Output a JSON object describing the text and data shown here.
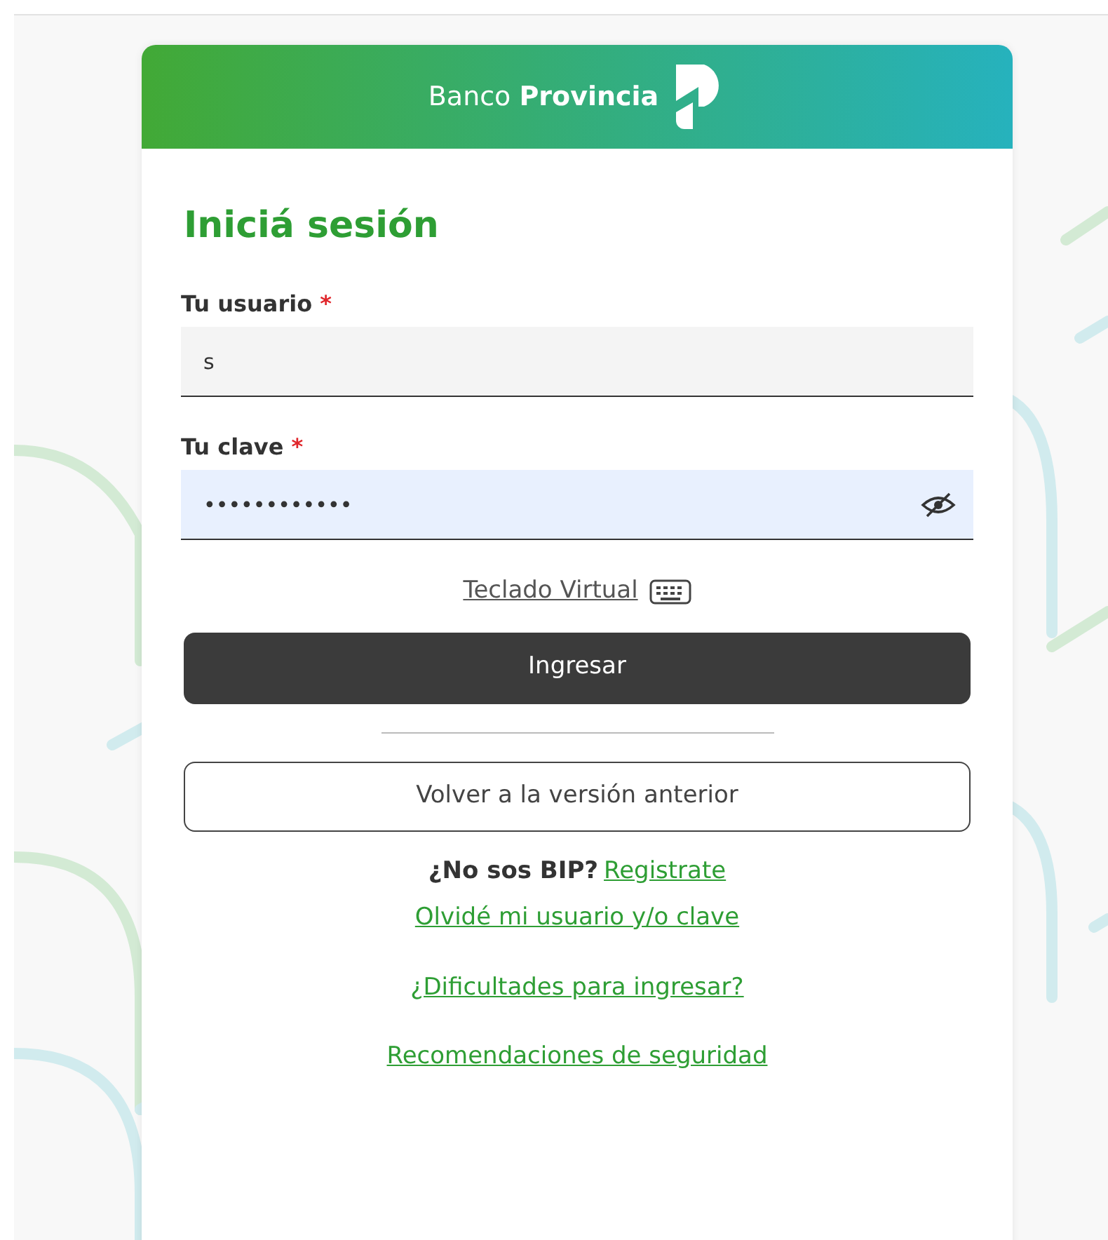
{
  "header": {
    "brand": "Banco **Provincia**"
  },
  "title": "Iniciá sesión",
  "fields": [
    {
      "kind": "text",
      "label": "Tu usuario",
      "required_mark": "*",
      "value": "s",
      "highlighted": false
    },
    {
      "kind": "password",
      "label": "Tu clave",
      "required_mark": "*",
      "value": "••••••••••••",
      "highlighted": true
    }
  ],
  "virtual_keyboard_link": "Teclado Virtual",
  "submit_button": "Ingresar",
  "previous_version_button": "Volver a la versión anterior",
  "register": {
    "prompt": "¿No sos BIP?",
    "link": "Registrate"
  },
  "links": [
    "Olvidé mi usuario y/o clave",
    "¿Dificultades para ingresar?",
    "Recomendaciones de seguridad"
  ]
}
